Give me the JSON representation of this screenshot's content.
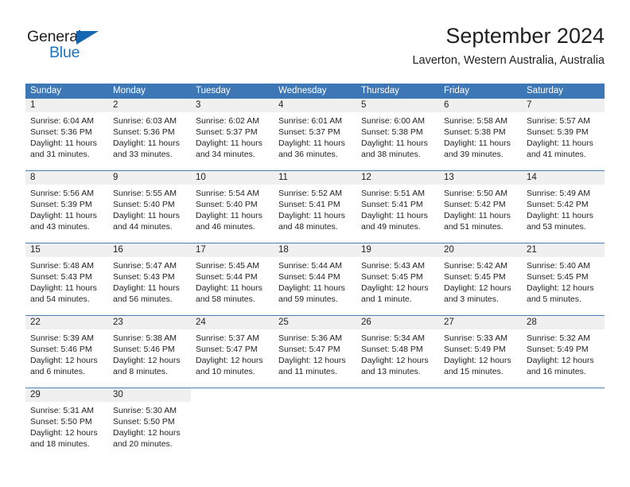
{
  "logo": {
    "word_one": "General",
    "word_two": "Blue",
    "triangle_icon": "triangle-icon",
    "brand_blue": "#1d73be",
    "brand_dark": "#231f20"
  },
  "header": {
    "title": "September 2024",
    "subtitle": "Laverton, Western Australia, Australia"
  },
  "theme": {
    "header_blue": "#3d77b6",
    "daynum_band": "#f0f0f0",
    "row_divider": "#4a7fb5",
    "text": "#231f20"
  },
  "weekdays": [
    "Sunday",
    "Monday",
    "Tuesday",
    "Wednesday",
    "Thursday",
    "Friday",
    "Saturday"
  ],
  "weeks": [
    [
      {
        "day": "1",
        "sunrise": "Sunrise: 6:04 AM",
        "sunset": "Sunset: 5:36 PM",
        "daylight_1": "Daylight: 11 hours",
        "daylight_2": "and 31 minutes."
      },
      {
        "day": "2",
        "sunrise": "Sunrise: 6:03 AM",
        "sunset": "Sunset: 5:36 PM",
        "daylight_1": "Daylight: 11 hours",
        "daylight_2": "and 33 minutes."
      },
      {
        "day": "3",
        "sunrise": "Sunrise: 6:02 AM",
        "sunset": "Sunset: 5:37 PM",
        "daylight_1": "Daylight: 11 hours",
        "daylight_2": "and 34 minutes."
      },
      {
        "day": "4",
        "sunrise": "Sunrise: 6:01 AM",
        "sunset": "Sunset: 5:37 PM",
        "daylight_1": "Daylight: 11 hours",
        "daylight_2": "and 36 minutes."
      },
      {
        "day": "5",
        "sunrise": "Sunrise: 6:00 AM",
        "sunset": "Sunset: 5:38 PM",
        "daylight_1": "Daylight: 11 hours",
        "daylight_2": "and 38 minutes."
      },
      {
        "day": "6",
        "sunrise": "Sunrise: 5:58 AM",
        "sunset": "Sunset: 5:38 PM",
        "daylight_1": "Daylight: 11 hours",
        "daylight_2": "and 39 minutes."
      },
      {
        "day": "7",
        "sunrise": "Sunrise: 5:57 AM",
        "sunset": "Sunset: 5:39 PM",
        "daylight_1": "Daylight: 11 hours",
        "daylight_2": "and 41 minutes."
      }
    ],
    [
      {
        "day": "8",
        "sunrise": "Sunrise: 5:56 AM",
        "sunset": "Sunset: 5:39 PM",
        "daylight_1": "Daylight: 11 hours",
        "daylight_2": "and 43 minutes."
      },
      {
        "day": "9",
        "sunrise": "Sunrise: 5:55 AM",
        "sunset": "Sunset: 5:40 PM",
        "daylight_1": "Daylight: 11 hours",
        "daylight_2": "and 44 minutes."
      },
      {
        "day": "10",
        "sunrise": "Sunrise: 5:54 AM",
        "sunset": "Sunset: 5:40 PM",
        "daylight_1": "Daylight: 11 hours",
        "daylight_2": "and 46 minutes."
      },
      {
        "day": "11",
        "sunrise": "Sunrise: 5:52 AM",
        "sunset": "Sunset: 5:41 PM",
        "daylight_1": "Daylight: 11 hours",
        "daylight_2": "and 48 minutes."
      },
      {
        "day": "12",
        "sunrise": "Sunrise: 5:51 AM",
        "sunset": "Sunset: 5:41 PM",
        "daylight_1": "Daylight: 11 hours",
        "daylight_2": "and 49 minutes."
      },
      {
        "day": "13",
        "sunrise": "Sunrise: 5:50 AM",
        "sunset": "Sunset: 5:42 PM",
        "daylight_1": "Daylight: 11 hours",
        "daylight_2": "and 51 minutes."
      },
      {
        "day": "14",
        "sunrise": "Sunrise: 5:49 AM",
        "sunset": "Sunset: 5:42 PM",
        "daylight_1": "Daylight: 11 hours",
        "daylight_2": "and 53 minutes."
      }
    ],
    [
      {
        "day": "15",
        "sunrise": "Sunrise: 5:48 AM",
        "sunset": "Sunset: 5:43 PM",
        "daylight_1": "Daylight: 11 hours",
        "daylight_2": "and 54 minutes."
      },
      {
        "day": "16",
        "sunrise": "Sunrise: 5:47 AM",
        "sunset": "Sunset: 5:43 PM",
        "daylight_1": "Daylight: 11 hours",
        "daylight_2": "and 56 minutes."
      },
      {
        "day": "17",
        "sunrise": "Sunrise: 5:45 AM",
        "sunset": "Sunset: 5:44 PM",
        "daylight_1": "Daylight: 11 hours",
        "daylight_2": "and 58 minutes."
      },
      {
        "day": "18",
        "sunrise": "Sunrise: 5:44 AM",
        "sunset": "Sunset: 5:44 PM",
        "daylight_1": "Daylight: 11 hours",
        "daylight_2": "and 59 minutes."
      },
      {
        "day": "19",
        "sunrise": "Sunrise: 5:43 AM",
        "sunset": "Sunset: 5:45 PM",
        "daylight_1": "Daylight: 12 hours",
        "daylight_2": "and 1 minute."
      },
      {
        "day": "20",
        "sunrise": "Sunrise: 5:42 AM",
        "sunset": "Sunset: 5:45 PM",
        "daylight_1": "Daylight: 12 hours",
        "daylight_2": "and 3 minutes."
      },
      {
        "day": "21",
        "sunrise": "Sunrise: 5:40 AM",
        "sunset": "Sunset: 5:45 PM",
        "daylight_1": "Daylight: 12 hours",
        "daylight_2": "and 5 minutes."
      }
    ],
    [
      {
        "day": "22",
        "sunrise": "Sunrise: 5:39 AM",
        "sunset": "Sunset: 5:46 PM",
        "daylight_1": "Daylight: 12 hours",
        "daylight_2": "and 6 minutes."
      },
      {
        "day": "23",
        "sunrise": "Sunrise: 5:38 AM",
        "sunset": "Sunset: 5:46 PM",
        "daylight_1": "Daylight: 12 hours",
        "daylight_2": "and 8 minutes."
      },
      {
        "day": "24",
        "sunrise": "Sunrise: 5:37 AM",
        "sunset": "Sunset: 5:47 PM",
        "daylight_1": "Daylight: 12 hours",
        "daylight_2": "and 10 minutes."
      },
      {
        "day": "25",
        "sunrise": "Sunrise: 5:36 AM",
        "sunset": "Sunset: 5:47 PM",
        "daylight_1": "Daylight: 12 hours",
        "daylight_2": "and 11 minutes."
      },
      {
        "day": "26",
        "sunrise": "Sunrise: 5:34 AM",
        "sunset": "Sunset: 5:48 PM",
        "daylight_1": "Daylight: 12 hours",
        "daylight_2": "and 13 minutes."
      },
      {
        "day": "27",
        "sunrise": "Sunrise: 5:33 AM",
        "sunset": "Sunset: 5:49 PM",
        "daylight_1": "Daylight: 12 hours",
        "daylight_2": "and 15 minutes."
      },
      {
        "day": "28",
        "sunrise": "Sunrise: 5:32 AM",
        "sunset": "Sunset: 5:49 PM",
        "daylight_1": "Daylight: 12 hours",
        "daylight_2": "and 16 minutes."
      }
    ],
    [
      {
        "day": "29",
        "sunrise": "Sunrise: 5:31 AM",
        "sunset": "Sunset: 5:50 PM",
        "daylight_1": "Daylight: 12 hours",
        "daylight_2": "and 18 minutes."
      },
      {
        "day": "30",
        "sunrise": "Sunrise: 5:30 AM",
        "sunset": "Sunset: 5:50 PM",
        "daylight_1": "Daylight: 12 hours",
        "daylight_2": "and 20 minutes."
      },
      {
        "day": "",
        "sunrise": "",
        "sunset": "",
        "daylight_1": "",
        "daylight_2": ""
      },
      {
        "day": "",
        "sunrise": "",
        "sunset": "",
        "daylight_1": "",
        "daylight_2": ""
      },
      {
        "day": "",
        "sunrise": "",
        "sunset": "",
        "daylight_1": "",
        "daylight_2": ""
      },
      {
        "day": "",
        "sunrise": "",
        "sunset": "",
        "daylight_1": "",
        "daylight_2": ""
      },
      {
        "day": "",
        "sunrise": "",
        "sunset": "",
        "daylight_1": "",
        "daylight_2": ""
      }
    ]
  ]
}
